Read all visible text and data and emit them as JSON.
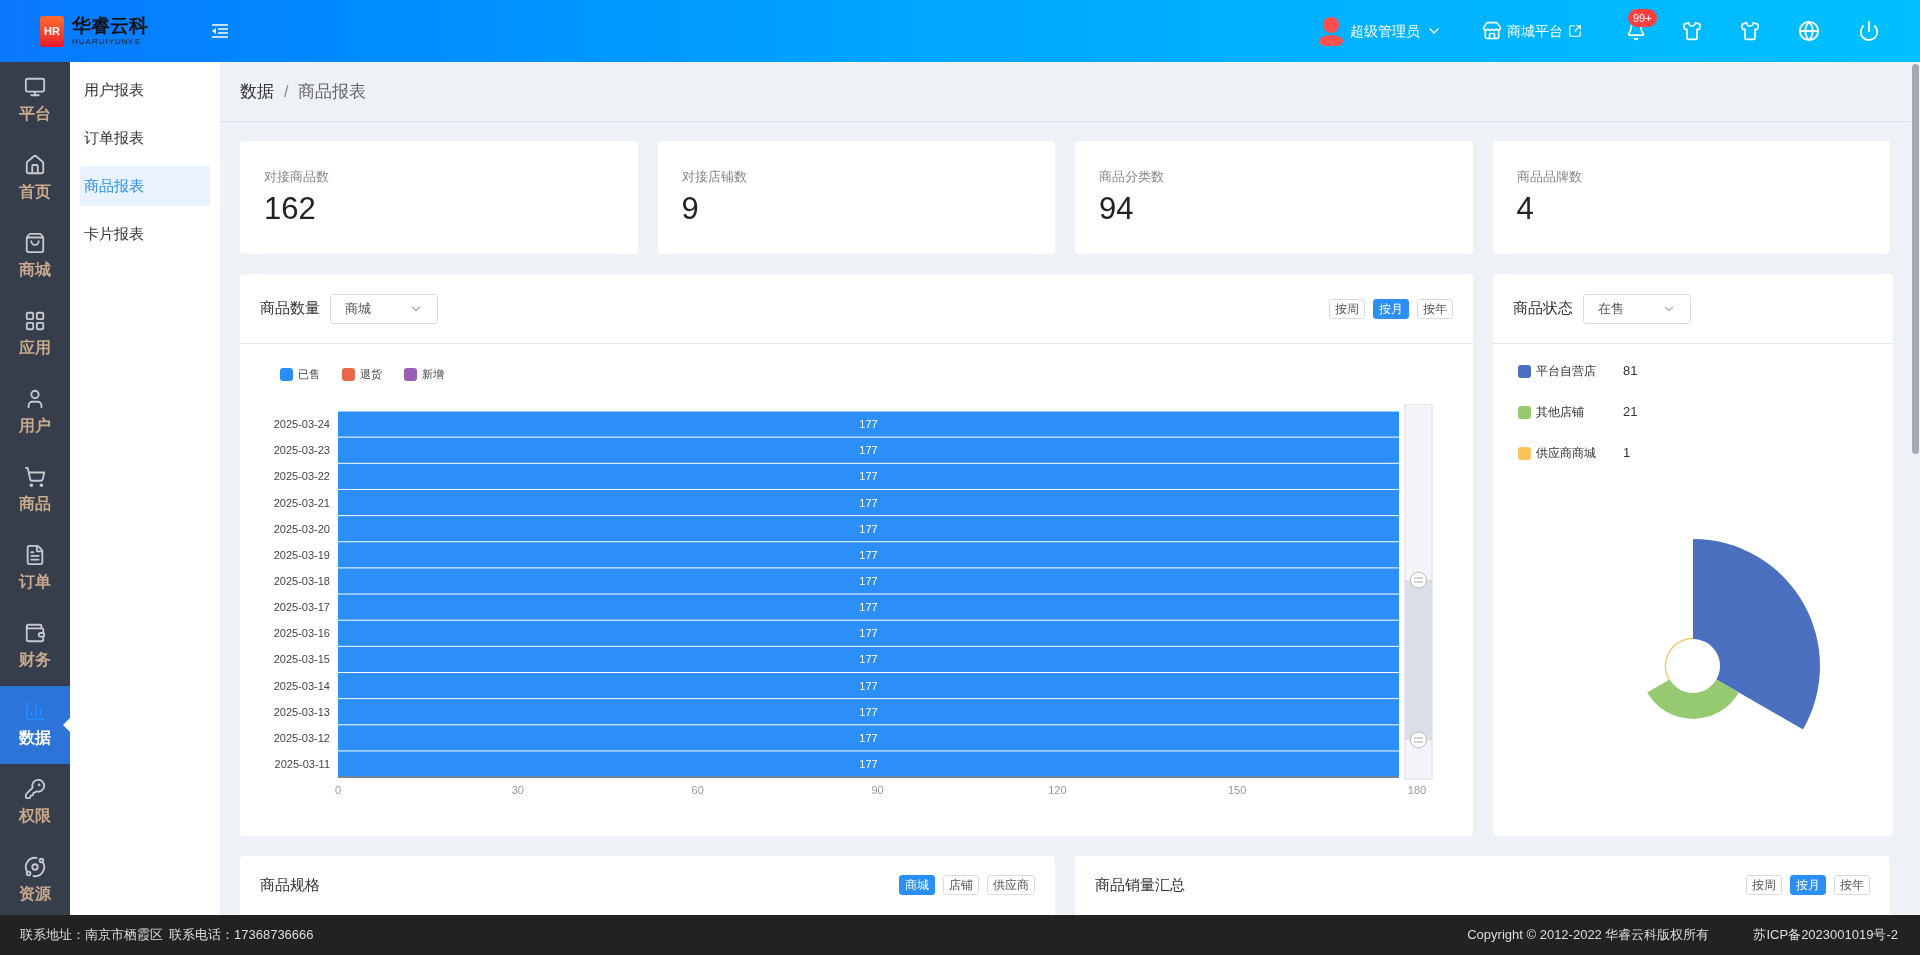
{
  "header": {
    "logo_mark": "HR",
    "brand": "华睿云科",
    "brand_subtitle": "HUARUIYUNKE",
    "user": "超级管理员",
    "platform_link": "商城平台",
    "notification_badge": "99+"
  },
  "sidebar": {
    "items": [
      {
        "label": "平台",
        "selected": false
      },
      {
        "label": "首页",
        "selected": false
      },
      {
        "label": "商城",
        "selected": false
      },
      {
        "label": "应用",
        "selected": false
      },
      {
        "label": "用户",
        "selected": false
      },
      {
        "label": "商品",
        "selected": false
      },
      {
        "label": "订单",
        "selected": false
      },
      {
        "label": "财务",
        "selected": false
      },
      {
        "label": "数据",
        "selected": true
      },
      {
        "label": "权限",
        "selected": false
      },
      {
        "label": "资源",
        "selected": false
      }
    ]
  },
  "submenu": {
    "items": [
      {
        "label": "用户报表",
        "selected": false
      },
      {
        "label": "订单报表",
        "selected": false
      },
      {
        "label": "商品报表",
        "selected": true
      },
      {
        "label": "卡片报表",
        "selected": false
      }
    ]
  },
  "breadcrumb": {
    "items": [
      "数据",
      "商品报表"
    ],
    "separator": "/"
  },
  "stats": [
    {
      "label": "对接商品数",
      "value": "162"
    },
    {
      "label": "对接店铺数",
      "value": "9"
    },
    {
      "label": "商品分类数",
      "value": "94"
    },
    {
      "label": "商品品牌数",
      "value": "4"
    }
  ],
  "product_count": {
    "title": "商品数量",
    "select": {
      "value": "商城"
    },
    "periods": [
      {
        "label": "按周",
        "selected": false
      },
      {
        "label": "按月",
        "selected": true
      },
      {
        "label": "按年",
        "selected": false
      }
    ],
    "chart_data": {
      "type": "bar",
      "orientation": "horizontal",
      "data_labels": true,
      "categories": [
        "2025-03-24",
        "2025-03-23",
        "2025-03-22",
        "2025-03-21",
        "2025-03-20",
        "2025-03-19",
        "2025-03-18",
        "2025-03-17",
        "2025-03-16",
        "2025-03-15",
        "2025-03-14",
        "2025-03-13",
        "2025-03-12",
        "2025-03-11"
      ],
      "series": [
        {
          "name": "已售",
          "color": "#2b8ff7",
          "values": [
            177,
            177,
            177,
            177,
            177,
            177,
            177,
            177,
            177,
            177,
            177,
            177,
            177,
            177
          ]
        },
        {
          "name": "退货",
          "color": "#e8684a",
          "values": [
            null,
            null,
            null,
            null,
            null,
            null,
            null,
            null,
            null,
            null,
            null,
            null,
            null,
            null
          ]
        },
        {
          "name": "新增",
          "color": "#9a60b4",
          "values": [
            null,
            null,
            null,
            null,
            null,
            null,
            null,
            null,
            null,
            null,
            null,
            null,
            null,
            null
          ]
        }
      ],
      "xlim": [
        0,
        180
      ],
      "xticks": [
        0,
        30,
        60,
        90,
        120,
        150,
        180
      ]
    }
  },
  "product_status": {
    "title": "商品状态",
    "select": {
      "value": "在售"
    },
    "legend": [
      {
        "label": "平台自营店",
        "value": "81",
        "color": "#4c70c0"
      },
      {
        "label": "其他店铺",
        "value": "21",
        "color": "#96ca70"
      },
      {
        "label": "供应商商城",
        "value": "1",
        "color": "#fbc25a"
      }
    ]
  },
  "product_specs": {
    "title": "商品规格",
    "filters": [
      {
        "label": "商城",
        "selected": true
      },
      {
        "label": "店铺",
        "selected": false
      },
      {
        "label": "供应商",
        "selected": false
      }
    ]
  },
  "sales_summary": {
    "title": "商品销量汇总",
    "periods": [
      {
        "label": "按周",
        "selected": false
      },
      {
        "label": "按月",
        "selected": true
      },
      {
        "label": "按年",
        "selected": false
      }
    ]
  },
  "footer": {
    "address": "联系地址：南京市栖霞区",
    "phone": "联系电话：17368736666",
    "copyright": "Copyright © 2012-2022 华睿云科版权所有",
    "icp": "苏ICP备2023001019号-2"
  }
}
